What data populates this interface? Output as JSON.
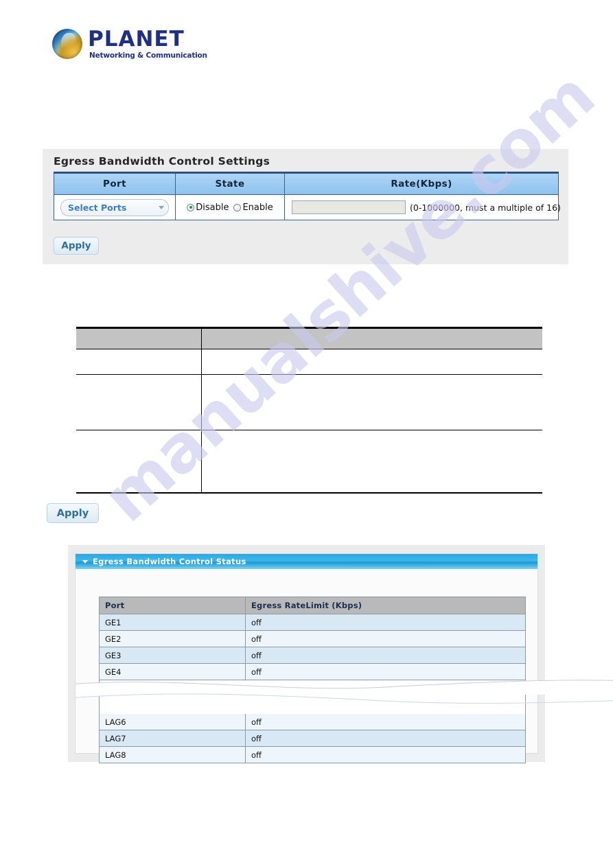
{
  "brand": {
    "logo_icon": "planet-globe-icon",
    "wordmark": "PLANET",
    "tagline": "Networking & Communication"
  },
  "settings_panel": {
    "title": "Egress Bandwidth Control Settings",
    "columns": [
      "Port",
      "State",
      "Rate(Kbps)"
    ],
    "port_select": {
      "label": "Select Ports",
      "caret_icon": "chevron-down-icon"
    },
    "state": {
      "options": [
        "Disable",
        "Enable"
      ],
      "selected": "Disable"
    },
    "rate": {
      "value": "",
      "placeholder": "",
      "hint": "(0-1000000, must a multiple of 16)"
    },
    "apply_label": "Apply"
  },
  "doc_table": {
    "headers": [
      "",
      ""
    ],
    "rows": [
      [
        "",
        ""
      ],
      [
        "",
        ""
      ],
      [
        "",
        ""
      ]
    ]
  },
  "standalone_apply": {
    "label": "Apply"
  },
  "status_panel": {
    "collapse_icon": "chevron-down-icon",
    "title": "Egress Bandwidth Control Status",
    "columns": [
      "Port",
      "Egress RateLimit (Kbps)"
    ],
    "rows_top": [
      {
        "port": "GE1",
        "rate": "off"
      },
      {
        "port": "GE2",
        "rate": "off"
      },
      {
        "port": "GE3",
        "rate": "off"
      },
      {
        "port": "GE4",
        "rate": "off"
      }
    ],
    "rows_bottom": [
      {
        "port": "LAG6",
        "rate": "off"
      },
      {
        "port": "LAG7",
        "rate": "off"
      },
      {
        "port": "LAG8",
        "rate": "off"
      }
    ]
  },
  "watermark": {
    "text": "manualshive.com"
  }
}
